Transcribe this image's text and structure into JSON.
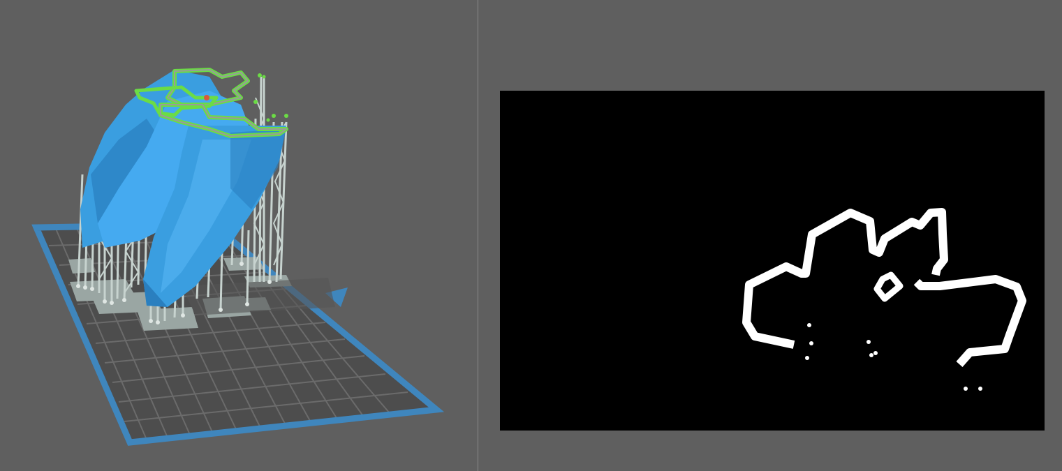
{
  "colors": {
    "background": "#5f5f5f",
    "divider": "#8a8a8a",
    "build_plate_frame": "#3f86bd",
    "build_plate_fill": "#4d4d4d",
    "build_plate_grid": "#6b6b6b",
    "model": "#3a9ee0",
    "model_shade": "#2a7fbf",
    "supports": "#c7d3cf",
    "support_pads": "#9aa6a3",
    "selected_layer": "#6bdc45",
    "slice_background": "#000000",
    "slice_fill": "#ffffff"
  },
  "viewport": {
    "view": "3d-model-preview",
    "content": [
      "build-plate",
      "model",
      "support-structures",
      "current-layer-outline"
    ]
  },
  "slice_preview": {
    "view": "layer-slice-image"
  }
}
